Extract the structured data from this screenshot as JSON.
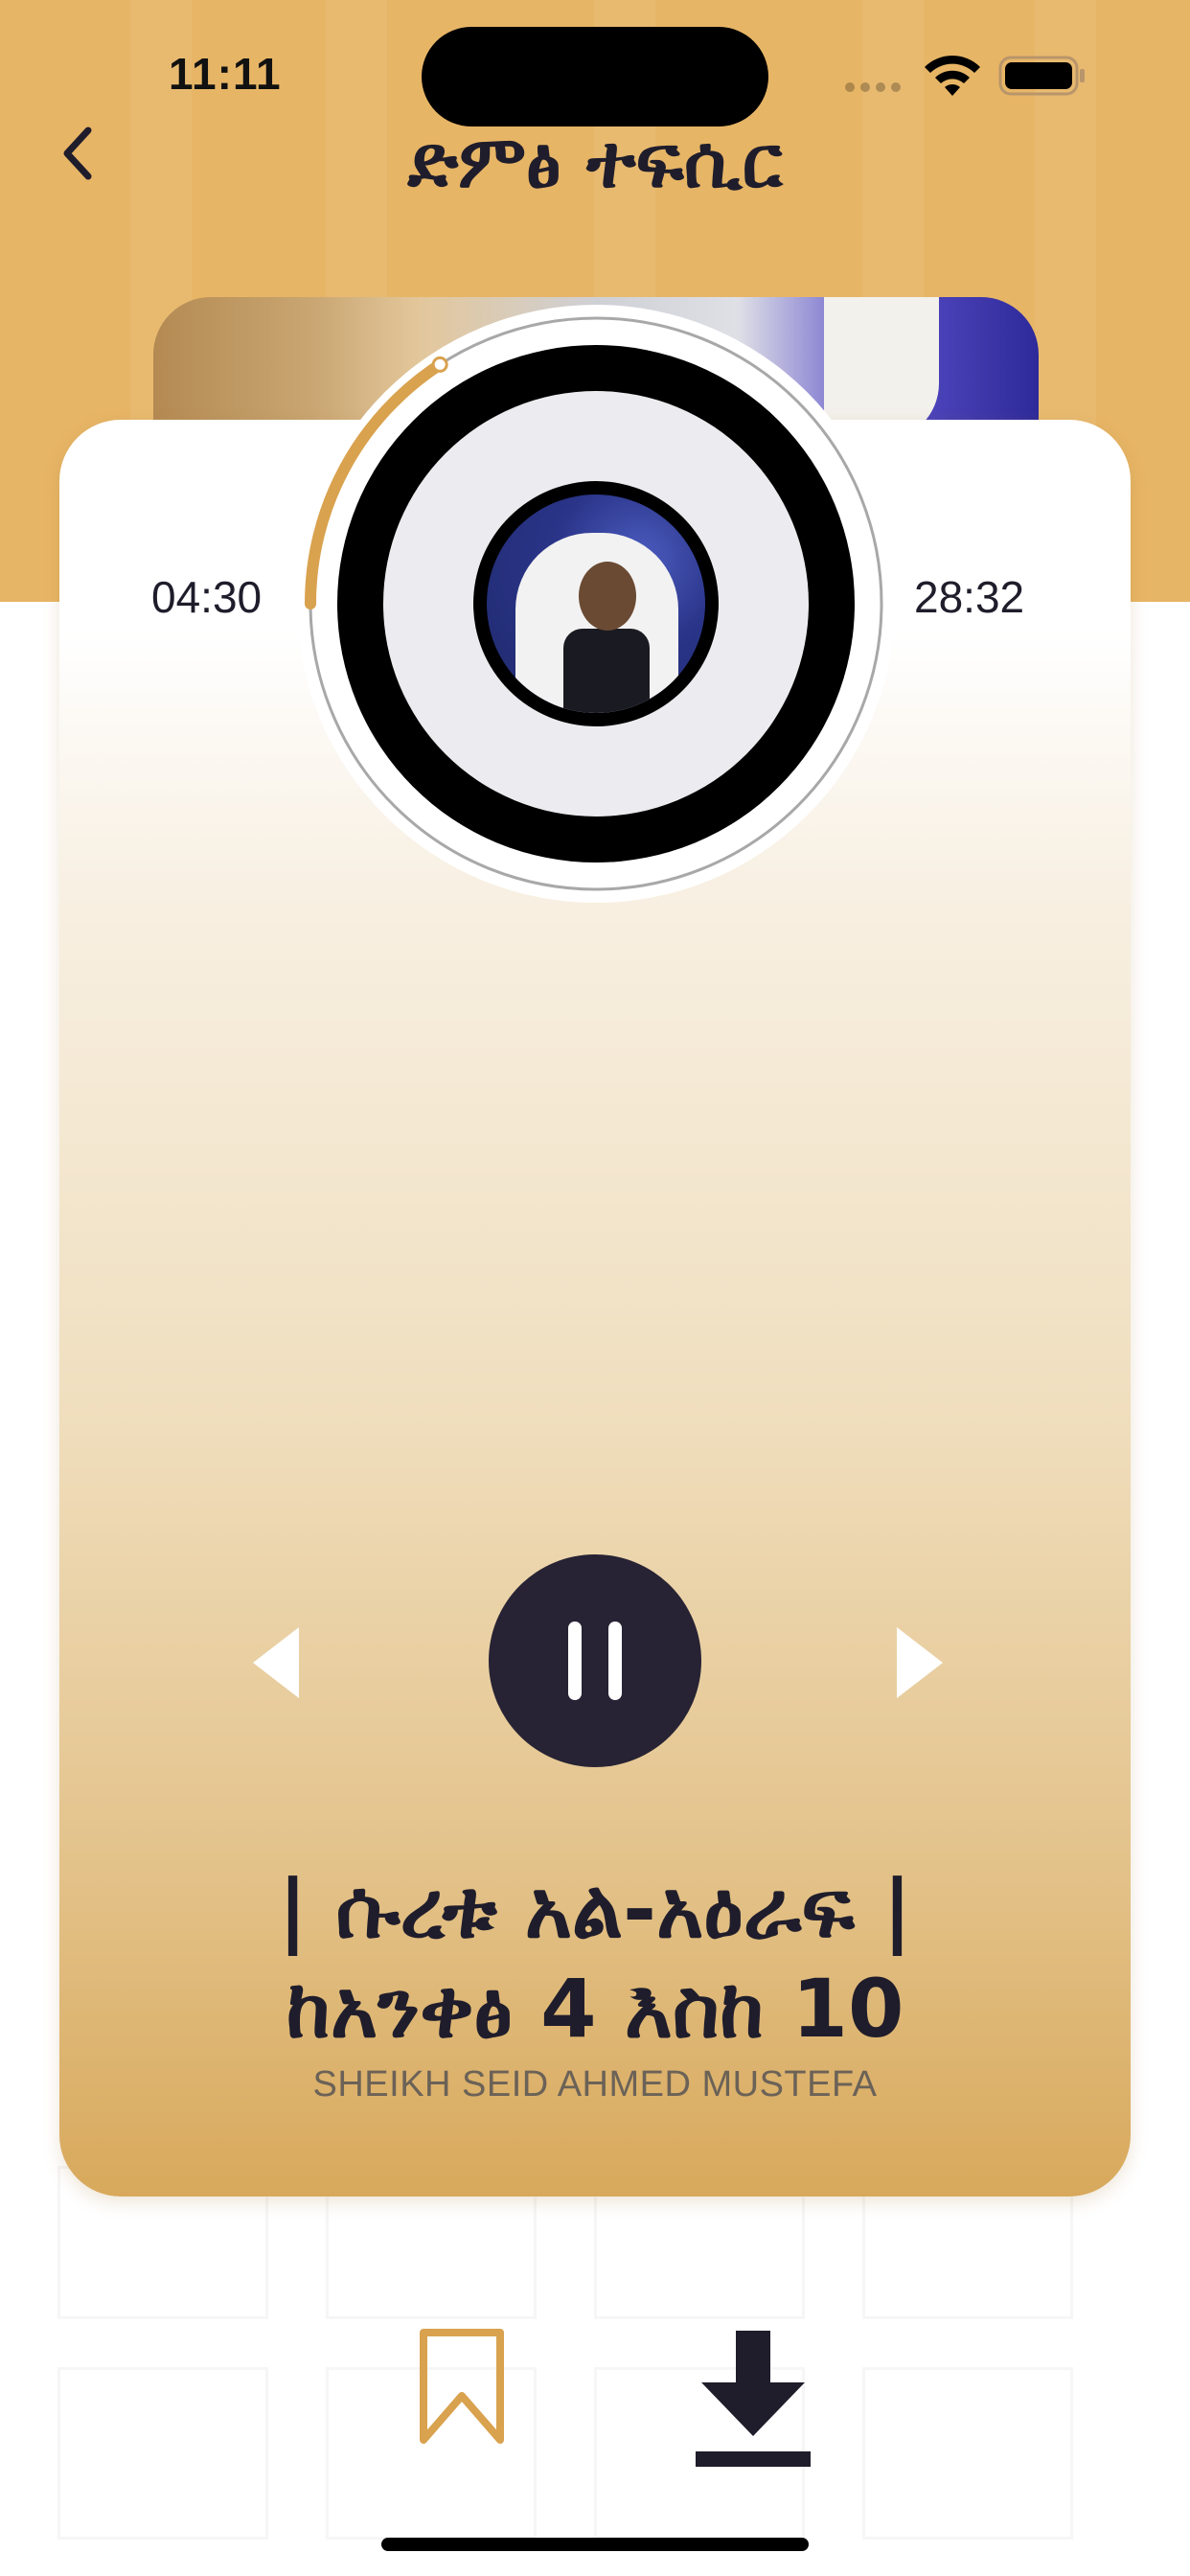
{
  "status_bar": {
    "time": "11:11"
  },
  "nav": {
    "title": "ድምፅ ተፍሲር",
    "back_icon": "chevron-left-icon"
  },
  "player": {
    "elapsed": "04:30",
    "total": "28:32",
    "progress_fraction": 0.158,
    "is_playing": true,
    "prev_icon": "triangle-left-icon",
    "next_icon": "triangle-right-icon",
    "pause_icon": "pause-icon"
  },
  "track": {
    "title_line1": "| ሱረቱ አል-አዕራፍ |",
    "title_line2": "ከአንቀፅ 4 እስከ 10",
    "artist": "SHEIKH SEID AHMED MUSTEFA"
  },
  "actions": {
    "bookmark_icon": "bookmark-icon",
    "download_icon": "download-icon"
  },
  "colors": {
    "accent_gold": "#e7b566",
    "progress_gold": "#d9a24e",
    "dark": "#272334"
  }
}
